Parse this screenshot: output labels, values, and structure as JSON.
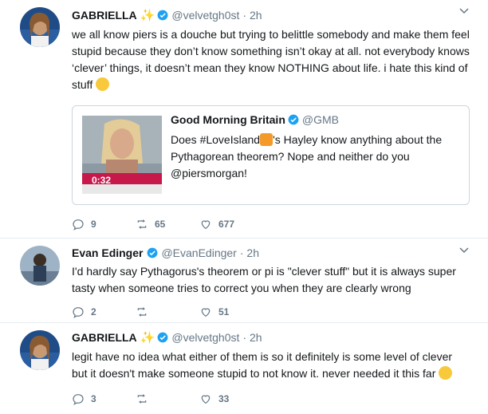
{
  "tweets": [
    {
      "name": "GABRIELLA",
      "handle": "@velvetgh0st",
      "time": "· 2h",
      "text": "we all know piers is a douche but trying to belittle somebody and make them feel stupid because they don’t know something isn’t okay at all. not everybody knows ‘clever’ things, it doesn’t mean they know NOTHING about life. i hate this kind of stuff",
      "replies": "9",
      "retweets": "65",
      "likes": "677"
    },
    {
      "name": "Evan Edinger",
      "handle": "@EvanEdinger",
      "time": "· 2h",
      "text": "I'd hardly say Pythagorus's theorem or pi is \"clever stuff\" but it is always super tasty when someone tries to correct you when they are clearly wrong",
      "replies": "2",
      "retweets": "",
      "likes": "51"
    },
    {
      "name": "GABRIELLA",
      "handle": "@velvetgh0st",
      "time": "· 2h",
      "text": "legit have no idea what either of them is so it definitely is some level of clever but it doesn't make someone stupid to not know it. never needed it this far",
      "replies": "3",
      "retweets": "",
      "likes": "33"
    }
  ],
  "quote": {
    "name": "Good Morning Britain",
    "handle": "@GMB",
    "text_part1": "Does #LoveIsland",
    "text_part2": "'s Hayley know anything about the Pythagorean theorem? Nope and neither do you @piersmorgan!",
    "video_time": "0:32"
  },
  "colors": {
    "verified": "#1da1f2",
    "secondary": "#657786",
    "sparkle": "#f5b800"
  }
}
